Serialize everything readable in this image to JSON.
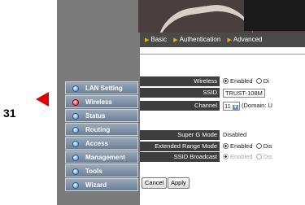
{
  "callout": {
    "number": "31"
  },
  "tabs": [
    {
      "label": "Basic"
    },
    {
      "label": "Authentication"
    },
    {
      "label": "Advanced"
    }
  ],
  "nav": {
    "items": [
      {
        "label": "LAN Setting",
        "active": false
      },
      {
        "label": "Wireless",
        "active": true
      },
      {
        "label": "Status",
        "active": false
      },
      {
        "label": "Routing",
        "active": false
      },
      {
        "label": "Access",
        "active": false
      },
      {
        "label": "Management",
        "active": false
      },
      {
        "label": "Tools",
        "active": false
      },
      {
        "label": "Wizard",
        "active": false
      }
    ]
  },
  "form": {
    "wireless": {
      "label": "Wireless",
      "opt1": "Enabled",
      "opt2": "Di"
    },
    "ssid": {
      "label": "SSID",
      "value": "TRUST-108M"
    },
    "channel": {
      "label": "Channel",
      "value": "11",
      "domain": "(Domain: U"
    },
    "superg": {
      "label": "Super G Mode",
      "value": "Disabled"
    },
    "extrange": {
      "label": "Extended Range Mode",
      "opt1": "Enabled",
      "opt2": "Dis"
    },
    "ssidbc": {
      "label": "SSID Broadcast",
      "opt1": "Enabled",
      "opt2": "Dis"
    }
  },
  "buttons": {
    "cancel": "Cancel",
    "apply": "Apply"
  },
  "colors": {
    "arrow": "#e00000",
    "nav_gradient_top": "#9aa9b8",
    "label_bg": "#3e3e3e",
    "frame_bg": "#7b7b7b"
  },
  "icons": {
    "nav_bullet": "bullet-icon",
    "nav_bullet_active": "bullet-active-icon",
    "tab_marker": "triangle-right-icon",
    "select_chevron": "chevron-down-icon"
  }
}
